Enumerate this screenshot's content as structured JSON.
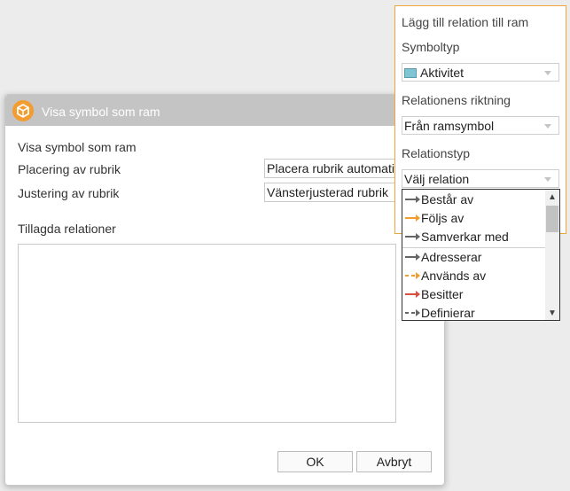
{
  "dialog": {
    "title": "Visa symbol som ram",
    "heading": "Visa symbol som ram",
    "placement_label": "Placering av rubrik",
    "placement_value": "Placera rubrik automatiskt",
    "alignment_label": "Justering av rubrik",
    "alignment_value": "Vänsterjusterad rubrik",
    "relations_label": "Tillagda relationer",
    "ok_label": "OK",
    "cancel_label": "Avbryt"
  },
  "panel": {
    "title": "Lägg till relation till ram",
    "symbol_type_label": "Symboltyp",
    "symbol_type_value": "Aktivitet",
    "direction_label": "Relationens riktning",
    "direction_value": "Från ramsymbol",
    "relation_type_label": "Relationstyp",
    "relation_type_value": "Välj relation"
  },
  "relation_options": [
    {
      "label": "Består av",
      "color": "#666666"
    },
    {
      "label": "Följs av",
      "color": "#f39c30"
    },
    {
      "label": "Samverkar med",
      "color": "#666666"
    },
    {
      "label": "Adresserar",
      "color": "#666666"
    },
    {
      "label": "Används av",
      "color": "#f39c30"
    },
    {
      "label": "Besitter",
      "color": "#d9503f"
    },
    {
      "label": "Definierar",
      "color": "#666666"
    }
  ],
  "colors": {
    "accent": "#f0a43a",
    "titlebar": "#c4c4c4",
    "symbol_swatch": "#7fc4d3"
  }
}
